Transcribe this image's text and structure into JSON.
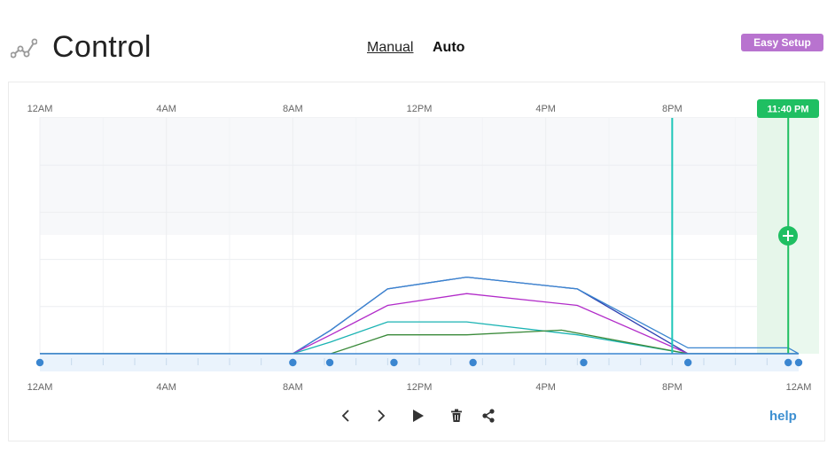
{
  "header": {
    "title": "Control",
    "icon": "chart-line-icon"
  },
  "mode_tabs": {
    "manual_label": "Manual",
    "auto_label": "Auto",
    "selected": "Auto"
  },
  "easy_setup_label": "Easy Setup",
  "help_label": "help",
  "current_time_label": "11:40 PM",
  "colors": {
    "easy_setup": "#b873cf",
    "current_time": "#1fbf62",
    "marker": "#1ec6b8",
    "handle": "#3b86d0",
    "help": "#3d8fd1"
  },
  "controls": [
    "chevron-left-icon",
    "chevron-right-icon",
    "play-icon",
    "trash-icon",
    "share-icon"
  ],
  "chart_data": {
    "type": "line",
    "x_unit": "hours since 12AM",
    "xlim": [
      0,
      24
    ],
    "ylim": [
      0,
      100
    ],
    "top_tick_labels": [
      "12AM",
      "4AM",
      "8AM",
      "12PM",
      "4PM",
      "8PM"
    ],
    "bottom_tick_labels": [
      "12AM",
      "4AM",
      "8AM",
      "12PM",
      "4PM",
      "8PM",
      "12AM"
    ],
    "tick_hours": [
      0,
      4,
      8,
      12,
      16,
      20,
      24
    ],
    "marker_hour": 20,
    "current_hour": 23.67,
    "handle_hours": [
      0,
      8,
      9.17,
      11.2,
      13.7,
      17.2,
      20.5,
      23.67,
      24
    ],
    "series": [
      {
        "color": "#2c3fb0",
        "points": [
          [
            0,
            0
          ],
          [
            8,
            0
          ],
          [
            9.2,
            10
          ],
          [
            11,
            27.5
          ],
          [
            13.5,
            32.5
          ],
          [
            17,
            27.5
          ],
          [
            20.5,
            0
          ],
          [
            24,
            0
          ]
        ]
      },
      {
        "color": "#3b86d0",
        "points": [
          [
            0,
            0
          ],
          [
            8,
            0
          ],
          [
            9.2,
            10
          ],
          [
            11,
            27.5
          ],
          [
            13.5,
            32.5
          ],
          [
            17,
            27.5
          ],
          [
            20.5,
            2.5
          ],
          [
            23.67,
            2.5
          ],
          [
            24,
            0
          ]
        ]
      },
      {
        "color": "#b22cc9",
        "points": [
          [
            0,
            0
          ],
          [
            8,
            0
          ],
          [
            9.2,
            8
          ],
          [
            11,
            20.5
          ],
          [
            13.5,
            25.5
          ],
          [
            17,
            20.5
          ],
          [
            20.5,
            0
          ],
          [
            24,
            0
          ]
        ]
      },
      {
        "color": "#1ab3b3",
        "points": [
          [
            0,
            0
          ],
          [
            8,
            0
          ],
          [
            9.2,
            5
          ],
          [
            11,
            13.5
          ],
          [
            13.5,
            13.5
          ],
          [
            17,
            8
          ],
          [
            20.5,
            0
          ],
          [
            24,
            0
          ]
        ]
      },
      {
        "color": "#3a8a3a",
        "points": [
          [
            0,
            0
          ],
          [
            9.2,
            0
          ],
          [
            11,
            8
          ],
          [
            13.5,
            8
          ],
          [
            16.5,
            10
          ],
          [
            20.5,
            0
          ],
          [
            24,
            0
          ]
        ]
      }
    ]
  }
}
